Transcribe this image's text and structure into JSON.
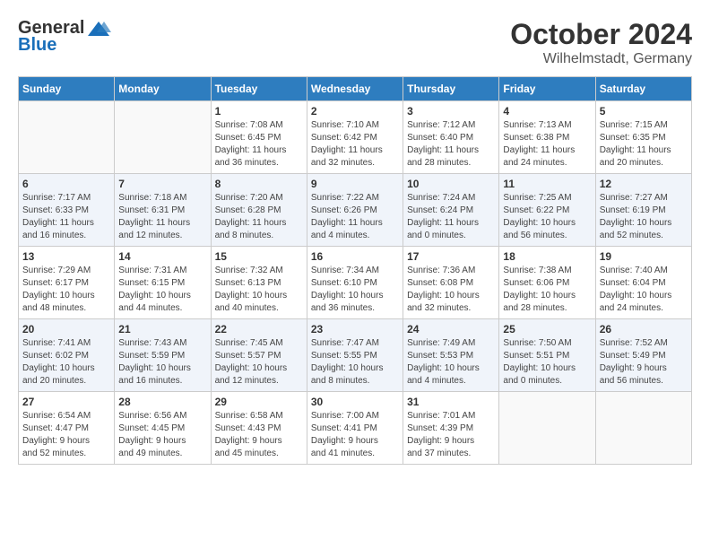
{
  "logo": {
    "general": "General",
    "blue": "Blue"
  },
  "title": {
    "month": "October 2024",
    "location": "Wilhelmstadt, Germany"
  },
  "headers": [
    "Sunday",
    "Monday",
    "Tuesday",
    "Wednesday",
    "Thursday",
    "Friday",
    "Saturday"
  ],
  "weeks": [
    [
      {
        "day": "",
        "info": ""
      },
      {
        "day": "",
        "info": ""
      },
      {
        "day": "1",
        "info": "Sunrise: 7:08 AM\nSunset: 6:45 PM\nDaylight: 11 hours\nand 36 minutes."
      },
      {
        "day": "2",
        "info": "Sunrise: 7:10 AM\nSunset: 6:42 PM\nDaylight: 11 hours\nand 32 minutes."
      },
      {
        "day": "3",
        "info": "Sunrise: 7:12 AM\nSunset: 6:40 PM\nDaylight: 11 hours\nand 28 minutes."
      },
      {
        "day": "4",
        "info": "Sunrise: 7:13 AM\nSunset: 6:38 PM\nDaylight: 11 hours\nand 24 minutes."
      },
      {
        "day": "5",
        "info": "Sunrise: 7:15 AM\nSunset: 6:35 PM\nDaylight: 11 hours\nand 20 minutes."
      }
    ],
    [
      {
        "day": "6",
        "info": "Sunrise: 7:17 AM\nSunset: 6:33 PM\nDaylight: 11 hours\nand 16 minutes."
      },
      {
        "day": "7",
        "info": "Sunrise: 7:18 AM\nSunset: 6:31 PM\nDaylight: 11 hours\nand 12 minutes."
      },
      {
        "day": "8",
        "info": "Sunrise: 7:20 AM\nSunset: 6:28 PM\nDaylight: 11 hours\nand 8 minutes."
      },
      {
        "day": "9",
        "info": "Sunrise: 7:22 AM\nSunset: 6:26 PM\nDaylight: 11 hours\nand 4 minutes."
      },
      {
        "day": "10",
        "info": "Sunrise: 7:24 AM\nSunset: 6:24 PM\nDaylight: 11 hours\nand 0 minutes."
      },
      {
        "day": "11",
        "info": "Sunrise: 7:25 AM\nSunset: 6:22 PM\nDaylight: 10 hours\nand 56 minutes."
      },
      {
        "day": "12",
        "info": "Sunrise: 7:27 AM\nSunset: 6:19 PM\nDaylight: 10 hours\nand 52 minutes."
      }
    ],
    [
      {
        "day": "13",
        "info": "Sunrise: 7:29 AM\nSunset: 6:17 PM\nDaylight: 10 hours\nand 48 minutes."
      },
      {
        "day": "14",
        "info": "Sunrise: 7:31 AM\nSunset: 6:15 PM\nDaylight: 10 hours\nand 44 minutes."
      },
      {
        "day": "15",
        "info": "Sunrise: 7:32 AM\nSunset: 6:13 PM\nDaylight: 10 hours\nand 40 minutes."
      },
      {
        "day": "16",
        "info": "Sunrise: 7:34 AM\nSunset: 6:10 PM\nDaylight: 10 hours\nand 36 minutes."
      },
      {
        "day": "17",
        "info": "Sunrise: 7:36 AM\nSunset: 6:08 PM\nDaylight: 10 hours\nand 32 minutes."
      },
      {
        "day": "18",
        "info": "Sunrise: 7:38 AM\nSunset: 6:06 PM\nDaylight: 10 hours\nand 28 minutes."
      },
      {
        "day": "19",
        "info": "Sunrise: 7:40 AM\nSunset: 6:04 PM\nDaylight: 10 hours\nand 24 minutes."
      }
    ],
    [
      {
        "day": "20",
        "info": "Sunrise: 7:41 AM\nSunset: 6:02 PM\nDaylight: 10 hours\nand 20 minutes."
      },
      {
        "day": "21",
        "info": "Sunrise: 7:43 AM\nSunset: 5:59 PM\nDaylight: 10 hours\nand 16 minutes."
      },
      {
        "day": "22",
        "info": "Sunrise: 7:45 AM\nSunset: 5:57 PM\nDaylight: 10 hours\nand 12 minutes."
      },
      {
        "day": "23",
        "info": "Sunrise: 7:47 AM\nSunset: 5:55 PM\nDaylight: 10 hours\nand 8 minutes."
      },
      {
        "day": "24",
        "info": "Sunrise: 7:49 AM\nSunset: 5:53 PM\nDaylight: 10 hours\nand 4 minutes."
      },
      {
        "day": "25",
        "info": "Sunrise: 7:50 AM\nSunset: 5:51 PM\nDaylight: 10 hours\nand 0 minutes."
      },
      {
        "day": "26",
        "info": "Sunrise: 7:52 AM\nSunset: 5:49 PM\nDaylight: 9 hours\nand 56 minutes."
      }
    ],
    [
      {
        "day": "27",
        "info": "Sunrise: 6:54 AM\nSunset: 4:47 PM\nDaylight: 9 hours\nand 52 minutes."
      },
      {
        "day": "28",
        "info": "Sunrise: 6:56 AM\nSunset: 4:45 PM\nDaylight: 9 hours\nand 49 minutes."
      },
      {
        "day": "29",
        "info": "Sunrise: 6:58 AM\nSunset: 4:43 PM\nDaylight: 9 hours\nand 45 minutes."
      },
      {
        "day": "30",
        "info": "Sunrise: 7:00 AM\nSunset: 4:41 PM\nDaylight: 9 hours\nand 41 minutes."
      },
      {
        "day": "31",
        "info": "Sunrise: 7:01 AM\nSunset: 4:39 PM\nDaylight: 9 hours\nand 37 minutes."
      },
      {
        "day": "",
        "info": ""
      },
      {
        "day": "",
        "info": ""
      }
    ]
  ]
}
